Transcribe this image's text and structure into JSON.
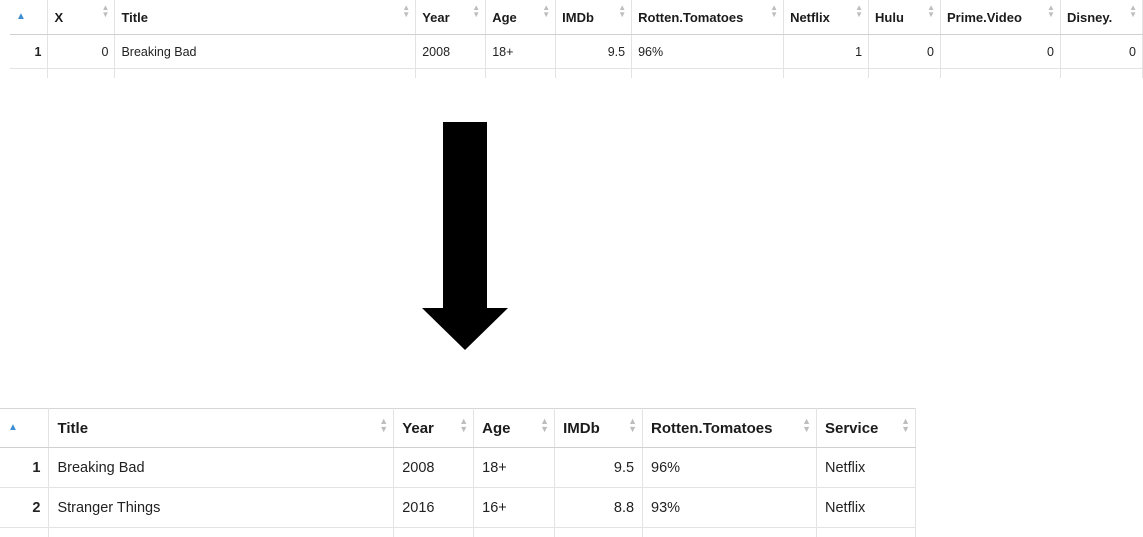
{
  "top_table": {
    "headers": [
      "X",
      "Title",
      "Year",
      "Age",
      "IMDb",
      "Rotten.Tomatoes",
      "Netflix",
      "Hulu",
      "Prime.Video",
      "Disney."
    ],
    "rows": [
      [
        "1",
        "0",
        "Breaking Bad",
        "2008",
        "18+",
        "9.5",
        "96%",
        "1",
        "0",
        "0",
        "0"
      ]
    ]
  },
  "bottom_table": {
    "headers": [
      "Title",
      "Year",
      "Age",
      "IMDb",
      "Rotten.Tomatoes",
      "Service"
    ],
    "rows": [
      [
        "1",
        "Breaking Bad",
        "2008",
        "18+",
        "9.5",
        "96%",
        "Netflix"
      ],
      [
        "2",
        "Stranger Things",
        "2016",
        "16+",
        "8.8",
        "93%",
        "Netflix"
      ]
    ]
  },
  "icons": {
    "sort_ascending": "sort-ascending-icon",
    "sort_both": "sort-both-icon",
    "arrow": "down-arrow-icon"
  },
  "colors": {
    "sort_accent": "#3d8fd1",
    "arrow": "#000000"
  }
}
